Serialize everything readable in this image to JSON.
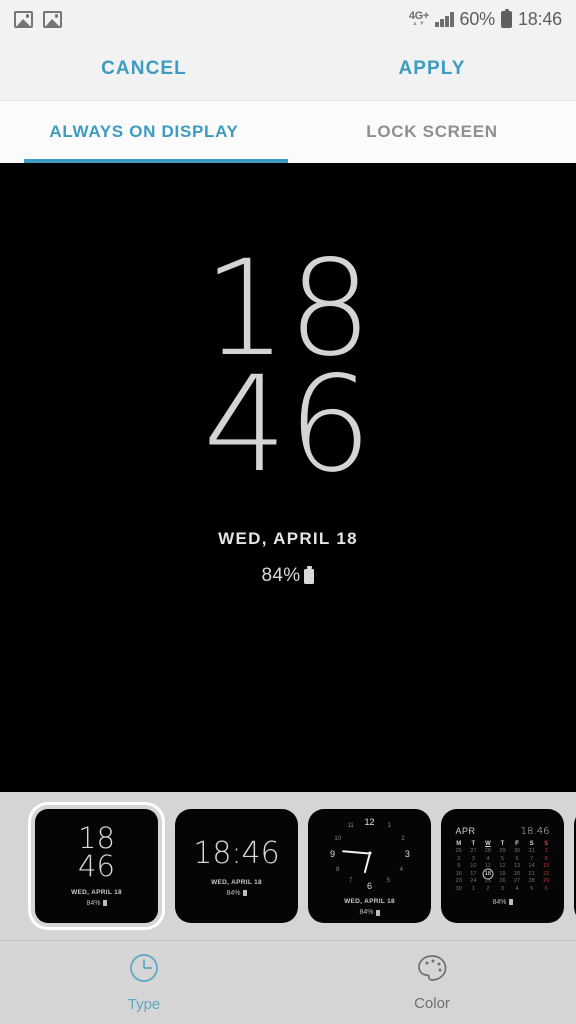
{
  "statusbar": {
    "notification_icons": [
      "image-icon",
      "image-icon"
    ],
    "network": "4G+",
    "network_arrows": "⇅",
    "battery_percent": "60%",
    "time": "18:46",
    "battery_icon": "battery-icon",
    "signal_icon": "signal-bars-icon"
  },
  "actionbar": {
    "cancel_label": "CANCEL",
    "apply_label": "APPLY",
    "accent_color": "#3d9cc0"
  },
  "tabs": [
    {
      "label": "ALWAYS ON DISPLAY",
      "active": true
    },
    {
      "label": "LOCK SCREEN",
      "active": false
    }
  ],
  "preview": {
    "hour": "18",
    "minute": "46",
    "date": "WED, APRIL 18",
    "battery": "84%",
    "background_color": "#000000",
    "text_color": "#d4d4d4"
  },
  "thumbnails": [
    {
      "id": "stacked-clock",
      "selected": true,
      "hour": "18",
      "minute": "46",
      "date": "WED, APRIL 18",
      "battery": "84%"
    },
    {
      "id": "inline-clock",
      "selected": false,
      "time": "18:46",
      "date": "WED, APRIL 18",
      "battery": "84%"
    },
    {
      "id": "analog-clock",
      "selected": false,
      "numbers": [
        "12",
        "1",
        "2",
        "3",
        "4",
        "5",
        "6",
        "7",
        "8",
        "9",
        "10",
        "11"
      ],
      "date": "WED, APRIL 18",
      "battery": "84%"
    },
    {
      "id": "calendar-clock",
      "selected": false,
      "month": "APR",
      "time": "18:46",
      "weekdays": [
        "M",
        "T",
        "W",
        "T",
        "F",
        "S",
        "S"
      ],
      "weeks": [
        [
          "26",
          "27",
          "28",
          "29",
          "30",
          "31",
          "1"
        ],
        [
          "2",
          "3",
          "4",
          "5",
          "6",
          "7",
          "8"
        ],
        [
          "9",
          "10",
          "11",
          "12",
          "13",
          "14",
          "15"
        ],
        [
          "16",
          "17",
          "18",
          "19",
          "20",
          "21",
          "22"
        ],
        [
          "23",
          "24",
          "25",
          "26",
          "27",
          "28",
          "29"
        ],
        [
          "30",
          "1",
          "2",
          "3",
          "4",
          "5",
          "6"
        ]
      ],
      "today": "18",
      "battery": "84%"
    }
  ],
  "bottombar": [
    {
      "label": "Type",
      "icon": "clock-icon",
      "active": true
    },
    {
      "label": "Color",
      "icon": "palette-icon",
      "active": false
    }
  ]
}
